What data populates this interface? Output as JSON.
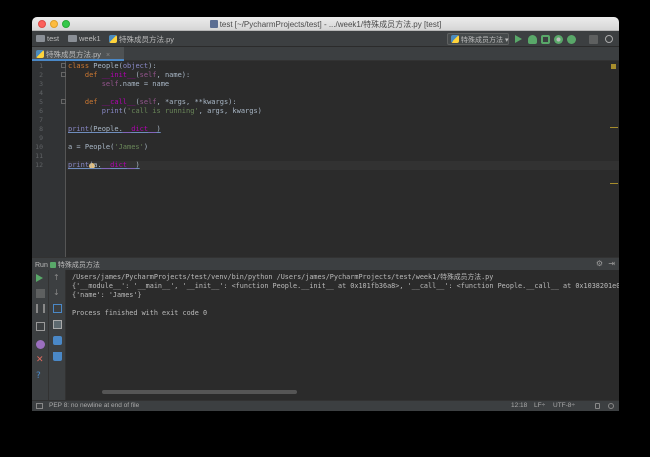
{
  "window": {
    "title": "test [~/PycharmProjects/test] - .../week1/特殊成员方法.py [test]"
  },
  "navbar": {
    "crumbs": [
      "test",
      "week1",
      "特殊成员方法.py"
    ],
    "run_config": "特殊成员方法"
  },
  "tabs": [
    {
      "label": "特殊成员方法.py",
      "close": "×"
    }
  ],
  "editor": {
    "line_numbers": [
      "1",
      "2",
      "3",
      "4",
      "5",
      "6",
      "7",
      "8",
      "9",
      "10",
      "11",
      "12"
    ],
    "caret_line": 12
  },
  "run_panel": {
    "title": "Run",
    "config": "特殊成员方法",
    "gear": "⚙",
    "hide": "⇥",
    "output": [
      "/Users/james/PycharmProjects/test/venv/bin/python /Users/james/PycharmProjects/test/week1/特殊成员方法.py",
      "{'__module__': '__main__', '__init__': <function People.__init__ at 0x101fb36a8>, '__call__': <function People.__call__ at 0x1038201e0>",
      "{'name': 'James'}",
      "",
      "Process finished with exit code 0"
    ]
  },
  "statusbar": {
    "message": "PEP 8: no newline at end of file",
    "position": "12:18",
    "line_sep": "LF÷",
    "encoding": "UTF-8÷"
  },
  "colors": {
    "background": "#2b2b2b",
    "keyword": "#cc7832",
    "function": "#ffc66d",
    "string": "#6a8759",
    "special": "#b200b2",
    "run_green": "#59a869"
  },
  "icons": [
    "folder-icon",
    "python-file-icon",
    "run-icon",
    "debug-icon",
    "coverage-icon",
    "profile-icon",
    "concurrency-icon",
    "stop-icon",
    "search-icon",
    "gear-icon",
    "bulb-icon"
  ]
}
